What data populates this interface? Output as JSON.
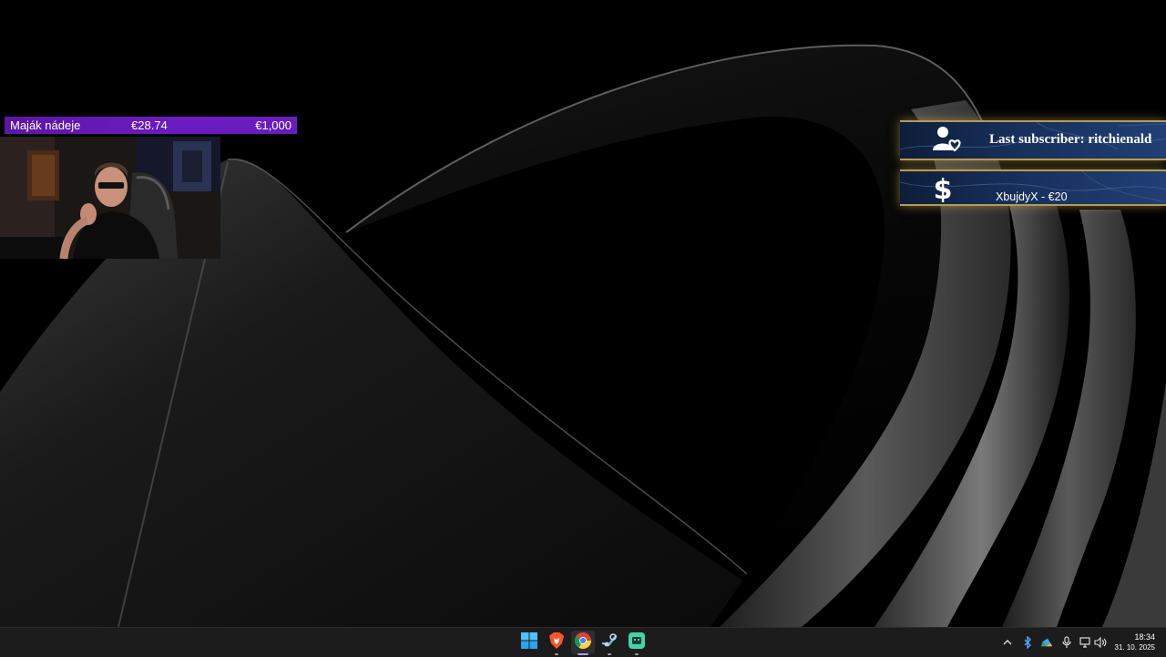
{
  "overlay": {
    "goal": {
      "name": "Maják nádeje",
      "current": "€28.74",
      "target": "€1,000",
      "progress_fraction": 0.029,
      "color": "#6a1cbc"
    },
    "subscriber_alert": {
      "text": "Last subscriber: ritchienald",
      "icon": "user-heart-icon"
    },
    "donation_alert": {
      "text": "XbujdyX - €20",
      "icon": "dollar-icon"
    },
    "accent_color": "#b79b52"
  },
  "taskbar": {
    "apps": [
      {
        "name": "Start",
        "icon": "windows-start-icon"
      },
      {
        "name": "Brave",
        "icon": "brave-browser-icon"
      },
      {
        "name": "Chrome",
        "icon": "chrome-browser-icon",
        "active": true
      },
      {
        "name": "Steam",
        "icon": "steam-icon"
      },
      {
        "name": "Streamer app",
        "icon": "app-icon"
      }
    ],
    "tray": [
      "chevron-up-icon",
      "bluetooth-icon",
      "cloud-sync-icon",
      "microphone-icon",
      "network-icon",
      "volume-icon"
    ],
    "clock": {
      "time": "18:34",
      "date": "31. 10. 2025"
    }
  }
}
